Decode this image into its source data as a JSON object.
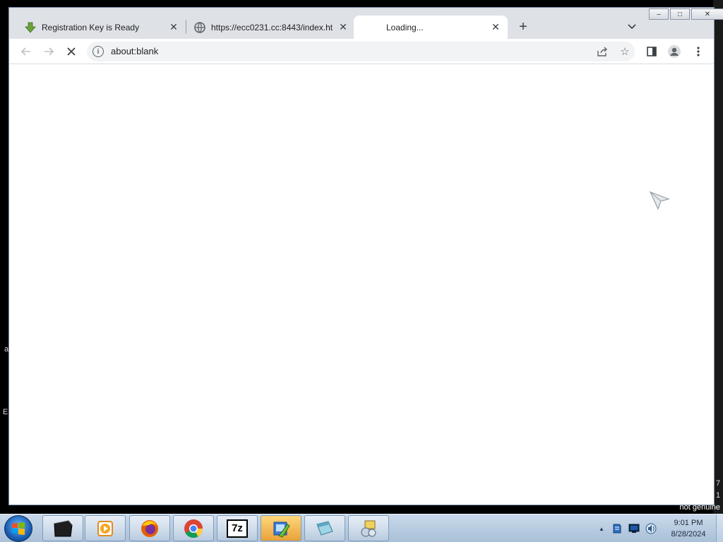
{
  "browser": {
    "tabs": [
      {
        "title": "Registration Key is Ready",
        "icon": "download-arrow-icon",
        "active": false
      },
      {
        "title": "https://ecc0231.cc:8443/index.ht",
        "icon": "globe-icon",
        "active": false
      },
      {
        "title": "Loading...",
        "icon": "",
        "active": true
      }
    ],
    "new_tab_label": "+",
    "address": "about:blank",
    "window_controls": {
      "minimize": "‒",
      "maximize": "□",
      "close": "✕"
    }
  },
  "desktop": {
    "fragment_left_1": "a",
    "fragment_left_2": "E",
    "fragment_right_1": "7",
    "fragment_right_2": "1",
    "watermark": "not genuine"
  },
  "taskbar": {
    "items": [
      {
        "name": "terminal-app",
        "icon": "terminal-icon"
      },
      {
        "name": "media-player-app",
        "icon": "media-player-icon"
      },
      {
        "name": "firefox-app",
        "icon": "firefox-icon"
      },
      {
        "name": "chrome-app",
        "icon": "chrome-icon"
      },
      {
        "name": "7zip-app",
        "icon": "7zip-icon",
        "label": "7z"
      },
      {
        "name": "installer-app",
        "icon": "installer-icon"
      },
      {
        "name": "window-app",
        "icon": "window-icon"
      },
      {
        "name": "tools-app",
        "icon": "tools-icon"
      }
    ],
    "tray": {
      "show_hidden_label": "▲",
      "time": "9:01 PM",
      "date": "8/28/2024"
    }
  },
  "colors": {
    "tabstrip": "#dee1e6",
    "omnibox": "#f1f3f4",
    "taskbar": "#b9cde2"
  }
}
